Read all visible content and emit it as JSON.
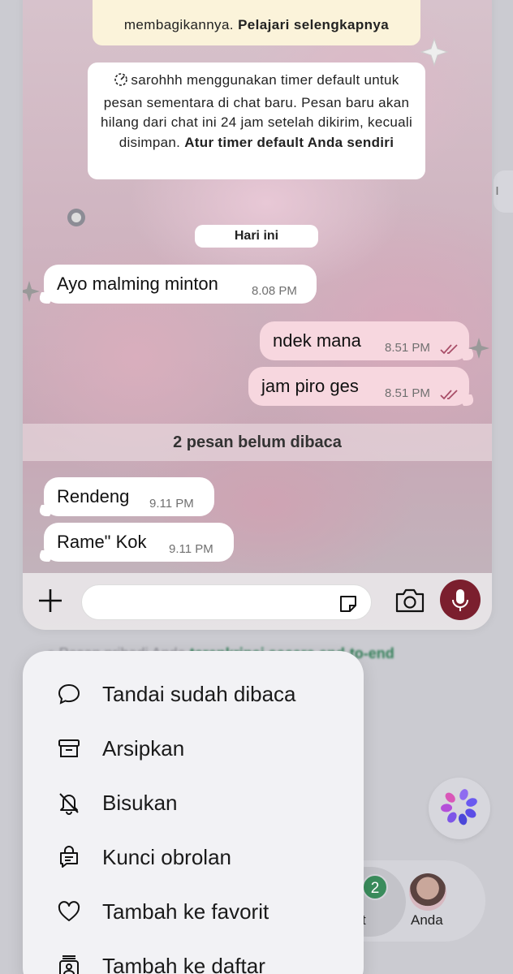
{
  "chat": {
    "notice_top_text": "membagikannya.",
    "notice_top_link": "Pelajari selengkapnya",
    "notice_timer_text": "sarohhh menggunakan timer default untuk pesan sementara di chat baru. Pesan baru akan hilang dari chat ini 24 jam setelah dikirim, kecuali disimpan.",
    "notice_timer_link": "Atur timer default Anda sendiri",
    "date_chip": "Hari ini",
    "messages": [
      {
        "direction": "in",
        "text": "Ayo malming minton",
        "time": "8.08 PM"
      },
      {
        "direction": "out",
        "text": "ndek mana",
        "time": "8.51 PM",
        "read": true
      },
      {
        "direction": "out",
        "text": "jam piro ges",
        "time": "8.51 PM",
        "read": true
      },
      {
        "direction": "in",
        "text": "Rendeng",
        "time": "9.11 PM"
      },
      {
        "direction": "in",
        "text": "Rame\" Kok",
        "time": "9.11 PM"
      }
    ],
    "unread_divider": "2 pesan belum dibaca",
    "input_placeholder": ""
  },
  "background": {
    "footer_text_partial": "Pesan pribadi Anda",
    "footer_link": "terenkripsi secara end-to-end",
    "tab_badge_count": "2",
    "tab_partial_label": "t",
    "profile_tab_label": "Anda"
  },
  "menu": {
    "items": [
      {
        "label": "Tandai sudah dibaca",
        "icon": "chat-bubble-icon"
      },
      {
        "label": "Arsipkan",
        "icon": "archive-icon"
      },
      {
        "label": "Bisukan",
        "icon": "bell-off-icon"
      },
      {
        "label": "Kunci obrolan",
        "icon": "lock-chat-icon"
      },
      {
        "label": "Tambah ke favorit",
        "icon": "heart-icon"
      },
      {
        "label": "Tambah ke daftar",
        "icon": "add-to-list-icon"
      }
    ]
  },
  "colors": {
    "accent_green": "#2f7d55",
    "mic_button": "#7b1f2e",
    "outgoing_bubble": "#f7d7df",
    "yellow_notice": "#fbf3da"
  }
}
